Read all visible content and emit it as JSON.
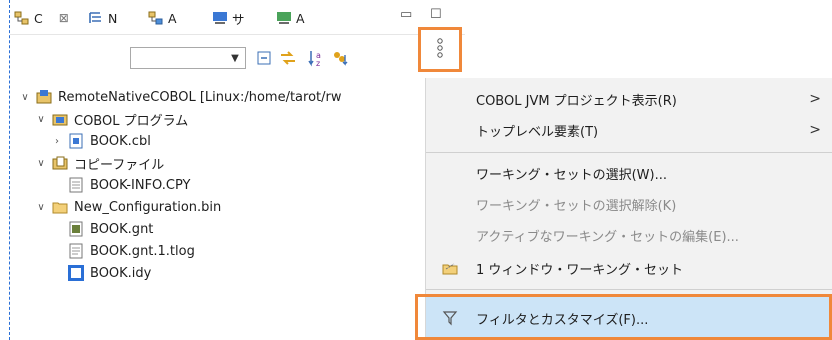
{
  "tabs": [
    {
      "label": "C",
      "icon": "package-explorer-icon",
      "active": true
    },
    {
      "label": "N",
      "icon": "navigator-icon"
    },
    {
      "label": "A",
      "icon": "project-explorer-icon"
    },
    {
      "label": "サ",
      "icon": "server-icon"
    },
    {
      "label": "A",
      "icon": "application-icon"
    }
  ],
  "toolbar": {
    "filter_value": "",
    "icons": [
      "dropdown-arrow-icon",
      "collapse-all-icon",
      "link-with-editor-icon",
      "sort-az-icon",
      "java-sort-icon",
      "view-menu-icon"
    ]
  },
  "tree": [
    {
      "label": "RemoteNativeCOBOL [Linux:/home/tarot/rw",
      "icon": "cobol-project-icon",
      "expanded": true
    },
    {
      "label": "COBOL プログラム",
      "icon": "cobol-program-folder-icon",
      "expanded": true
    },
    {
      "label": "BOOK.cbl",
      "icon": "cobol-source-icon",
      "expanded": false
    },
    {
      "label": "コピーファイル",
      "icon": "copybook-folder-icon",
      "expanded": true
    },
    {
      "label": "BOOK-INFO.CPY",
      "icon": "copybook-file-icon"
    },
    {
      "label": "New_Configuration.bin",
      "icon": "folder-icon",
      "expanded": true
    },
    {
      "label": "BOOK.gnt",
      "icon": "gnt-file-icon"
    },
    {
      "label": "BOOK.gnt.1.tlog",
      "icon": "text-file-icon"
    },
    {
      "label": "BOOK.idy",
      "icon": "idy-file-icon"
    }
  ],
  "menu": {
    "items": [
      {
        "label": "COBOL JVM プロジェクト表示(R)",
        "submenu": true
      },
      {
        "label": "トップレベル要素(T)",
        "submenu": true
      },
      {
        "label": "ワーキング・セットの選択(W)..."
      },
      {
        "label": "ワーキング・セットの選択解除(K)",
        "disabled": true
      },
      {
        "label": "アクティブなワーキング・セットの編集(E)...",
        "disabled": true
      },
      {
        "label": "1 ウィンドウ・ワーキング・セット",
        "icon": "working-set-icon"
      },
      {
        "label": "フィルタとカスタマイズ(F)...",
        "icon": "filter-icon",
        "selected": true
      }
    ],
    "submenu_glyph": ">"
  },
  "colors": {
    "highlight": "#f0883a",
    "selection": "#cce4f7",
    "menu_bg": "#f2f2f2"
  }
}
